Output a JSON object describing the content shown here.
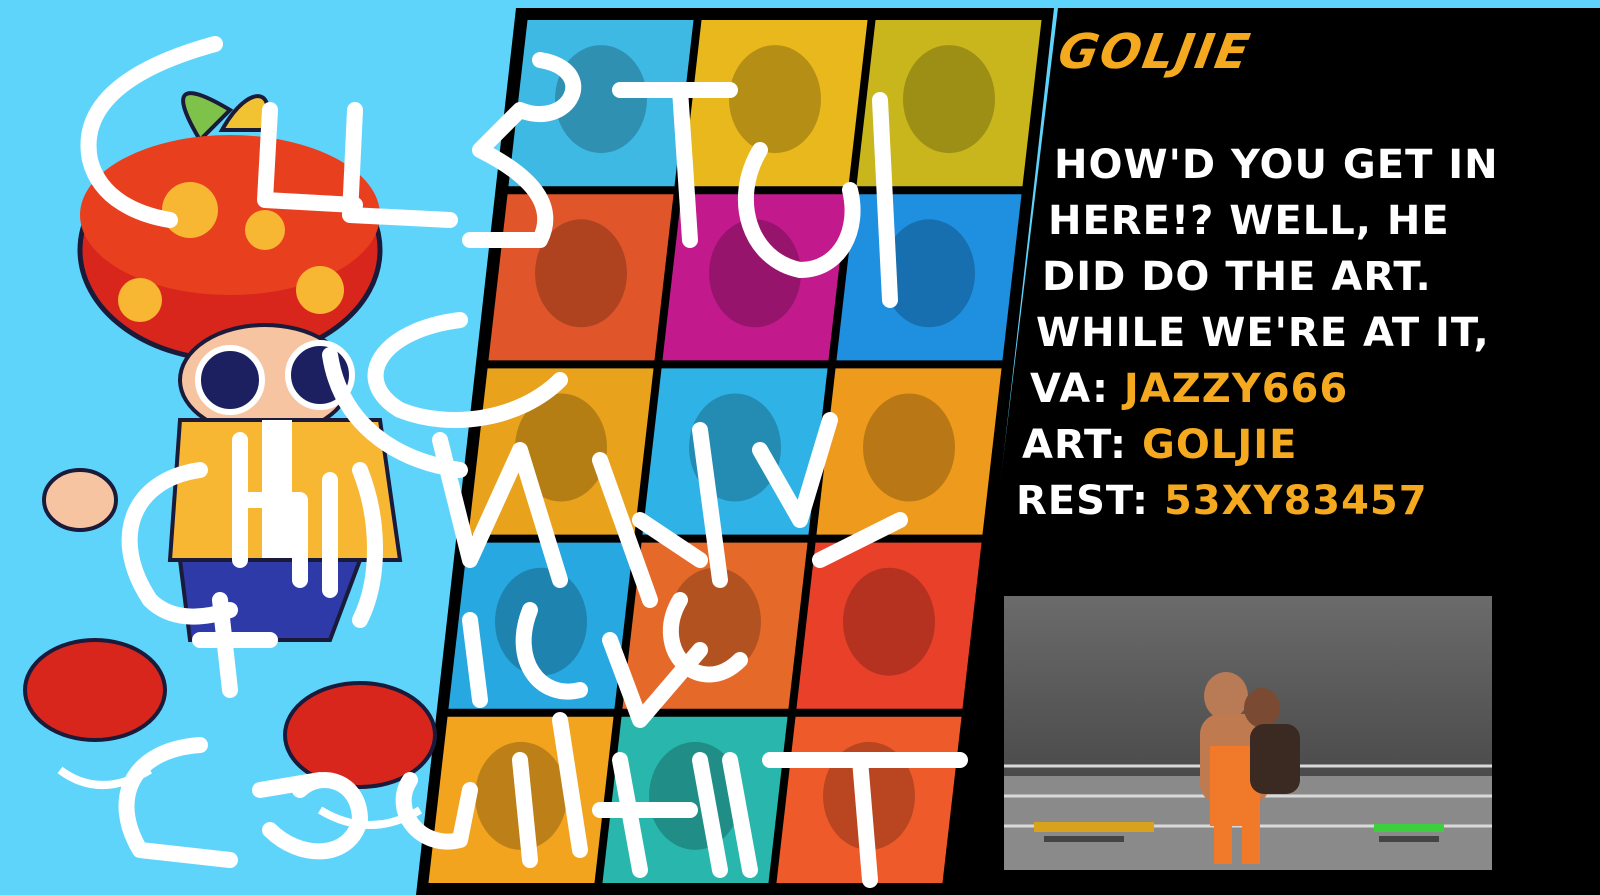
{
  "character": {
    "name": "GOLJIE",
    "description_lines": [
      "HOW'D YOU GET IN",
      "HERE!? WELL, HE",
      "DID DO THE ART.",
      "WHILE WE'RE AT IT,"
    ],
    "credits": [
      {
        "label": "VA:",
        "value": "JAZZY666"
      },
      {
        "label": "ART:",
        "value": "GOLJIE"
      },
      {
        "label": "REST:",
        "value": "53XY83457"
      }
    ]
  },
  "roster": {
    "grid_columns": 3,
    "grid_rows": 5,
    "tile_colors": [
      "#3db9e4",
      "#e8b81c",
      "#c9b61d",
      "#e0562a",
      "#c21a8c",
      "#1f8fe0",
      "#e8a21c",
      "#2fb3e6",
      "#ee9a1c",
      "#27a8e0",
      "#e56a2a",
      "#e9402a",
      "#f3a41f",
      "#29b7ad",
      "#ee5a2a"
    ]
  },
  "colors": {
    "background": "#5fd4fb",
    "panel": "#000000",
    "accent": "#f5a91f",
    "text": "#ffffff",
    "scribble": "#ffffff"
  },
  "icons": [
    "mushroom-character-icon",
    "wrestling-clip-icon"
  ]
}
